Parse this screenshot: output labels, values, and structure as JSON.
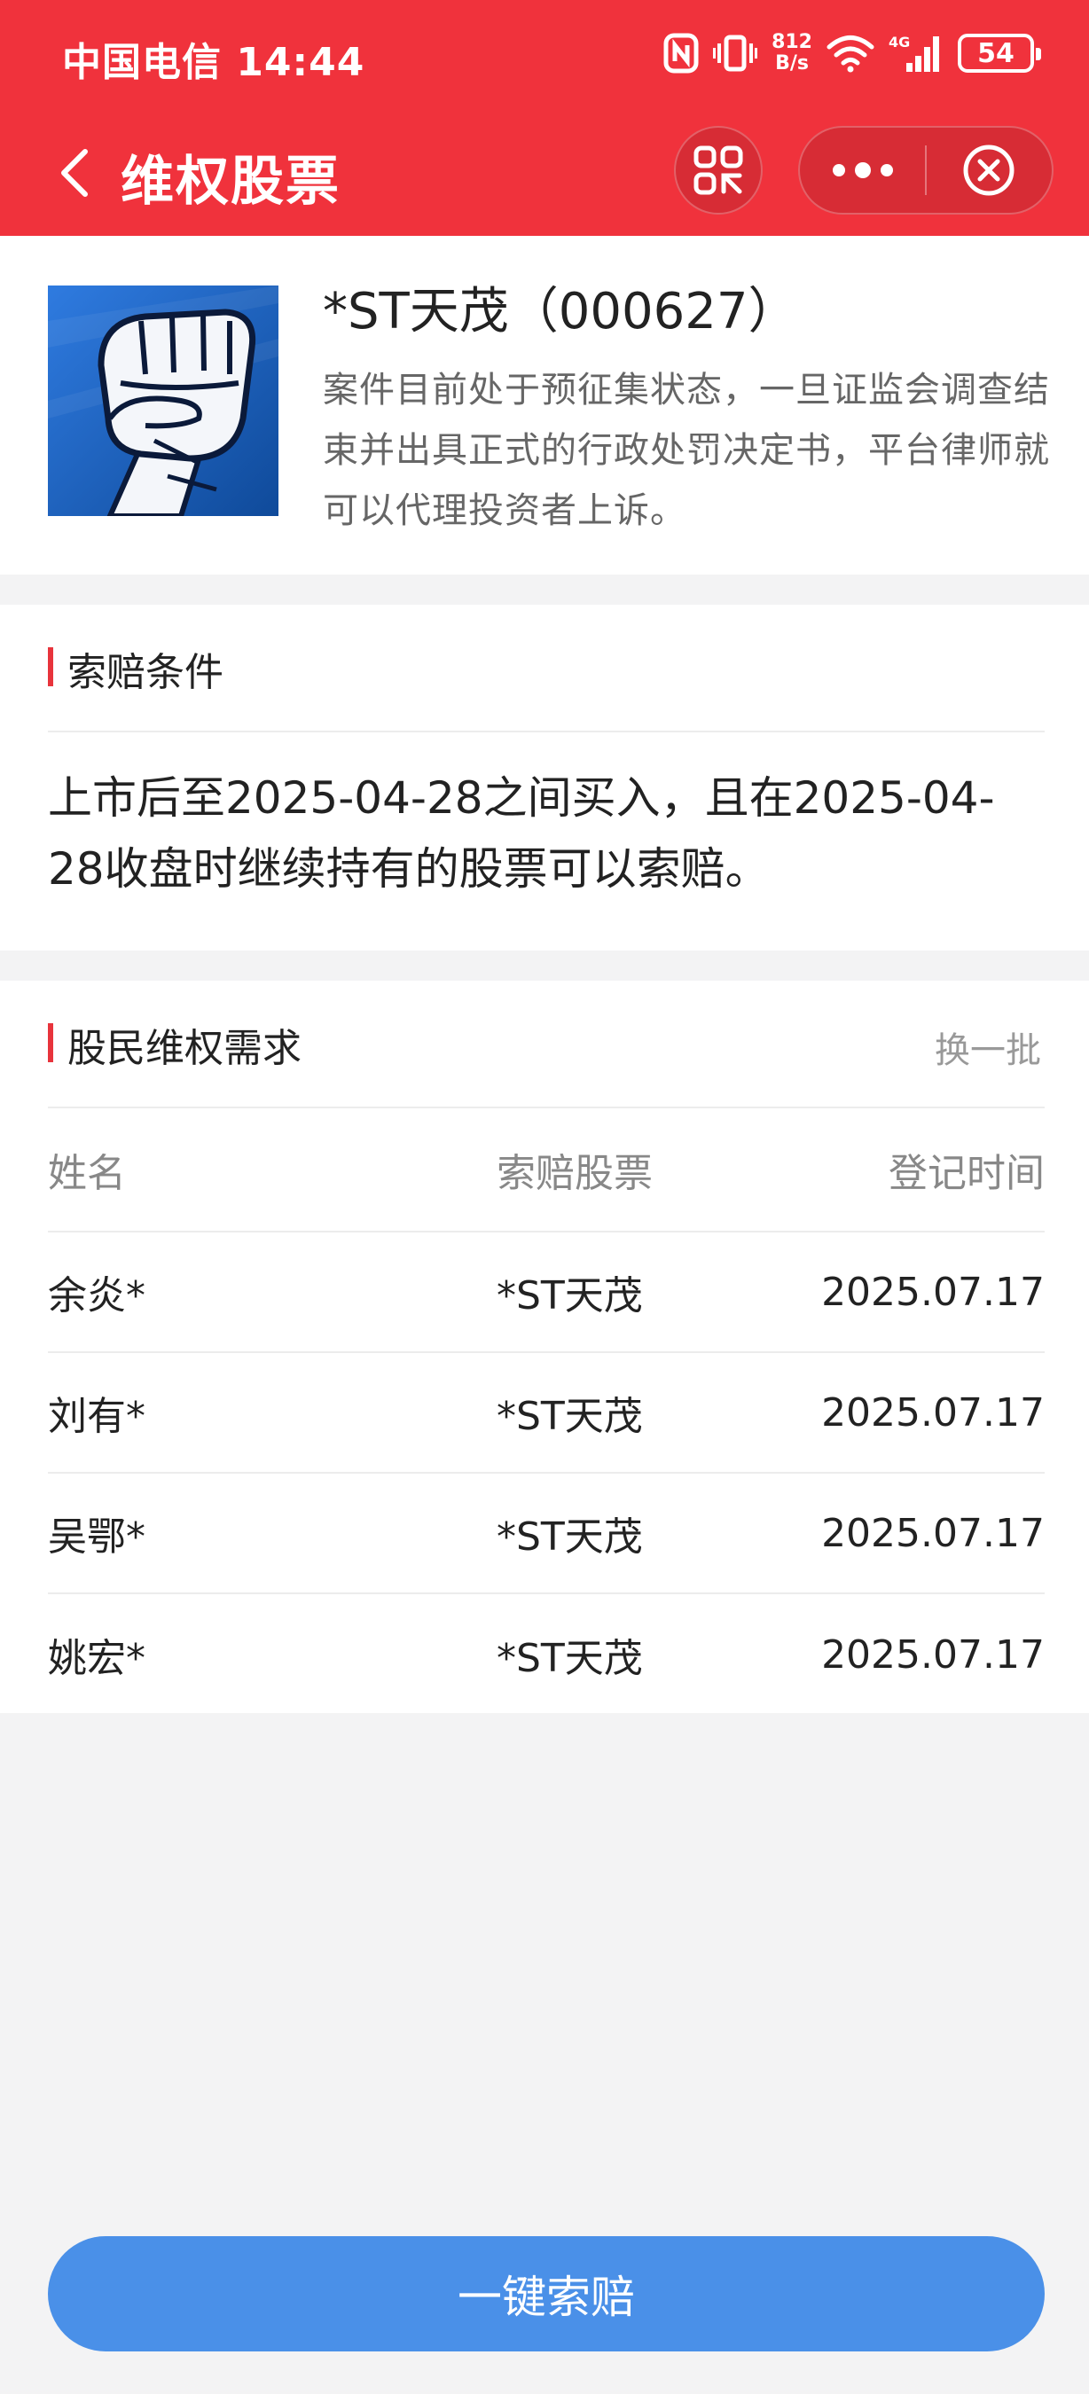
{
  "status_bar": {
    "carrier_time": "中国电信 14:44",
    "net_speed_value": "812",
    "net_speed_unit": "B/s",
    "network_type": "4G",
    "battery": "54"
  },
  "nav": {
    "title": "维权股票"
  },
  "stock": {
    "name": "*ST天茂（000627）",
    "description": "案件目前处于预征集状态，一旦证监会调查结束并出具正式的行政处罚决定书，平台律师就可以代理投资者上诉。"
  },
  "conditions": {
    "title": "索赔条件",
    "text": "上市后至2025-04-28之间买入，且在2025-04-28收盘时继续持有的股票可以索赔。"
  },
  "demands": {
    "title": "股民维权需求",
    "refresh": "换一批",
    "columns": [
      "姓名",
      "索赔股票",
      "登记时间"
    ],
    "rows": [
      {
        "name": "余炎*",
        "stock": "*ST天茂",
        "date": "2025.07.17"
      },
      {
        "name": "刘有*",
        "stock": "*ST天茂",
        "date": "2025.07.17"
      },
      {
        "name": "吴鄂*",
        "stock": "*ST天茂",
        "date": "2025.07.17"
      },
      {
        "name": "姚宏*",
        "stock": "*ST天茂",
        "date": "2025.07.17"
      }
    ]
  },
  "claim_button": "一键索赔",
  "colors": {
    "header_red": "#f0323c",
    "accent_red": "#e8343c",
    "button_blue": "#4a90e8",
    "background": "#f3f3f4"
  },
  "icons": {
    "back": "chevron-left-icon",
    "scan": "scan-code-icon",
    "more": "more-dots-icon",
    "close": "close-circle-icon",
    "logo": "raised-fist-icon"
  }
}
